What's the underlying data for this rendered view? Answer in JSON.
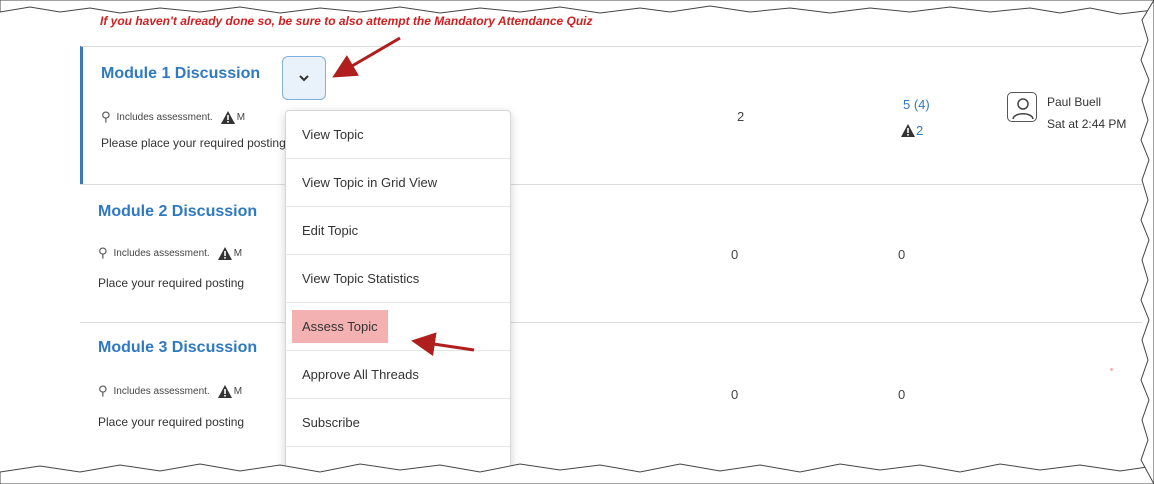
{
  "notice": "If you haven't already done so, be sure to also attempt the Mandatory Attendance Quiz",
  "topics": [
    {
      "title": "Module 1 Discussion",
      "assessment_label": "Includes assessment.",
      "warning_trunc": "M",
      "description": "Please place your required posting",
      "threads": "2",
      "posts": "5 (4)",
      "flagged": "2"
    },
    {
      "title": "Module 2 Discussion",
      "assessment_label": "Includes assessment.",
      "warning_trunc": "M",
      "description": "Place your required posting",
      "threads": "0",
      "posts": "0"
    },
    {
      "title": "Module 3 Discussion",
      "assessment_label": "Includes assessment.",
      "warning_trunc": "M",
      "description": "Place your required posting",
      "threads": "0",
      "posts": "0"
    }
  ],
  "last_post": {
    "user": "Paul Buell",
    "time": "Sat at 2:44 PM"
  },
  "menu": {
    "items": [
      "View Topic",
      "View Topic in Grid View",
      "Edit Topic",
      "View Topic Statistics",
      "Assess Topic",
      "Approve All Threads",
      "Subscribe"
    ]
  },
  "icons": {
    "dropdown": "chevron-down-icon",
    "pin": "pin-icon",
    "warning": "warning-icon",
    "avatar": "user-avatar-icon",
    "arrow": "annotation-arrow-icon"
  },
  "colors": {
    "link": "#2f79c1",
    "notice": "#d21e1e",
    "highlight": "#f4b1b1",
    "arrow": "#b01e1e",
    "selected_border": "#3d7ab8"
  }
}
